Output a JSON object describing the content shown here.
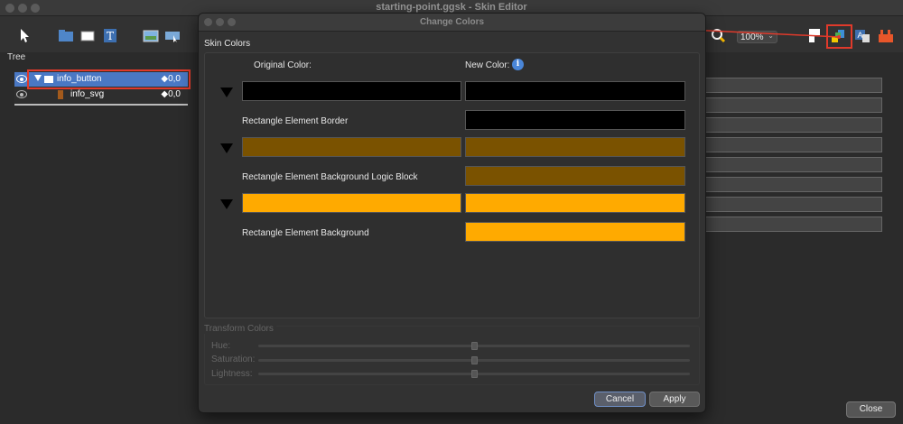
{
  "window": {
    "title": "starting-point.ggsk - Skin Editor",
    "zoom": "100%",
    "tree_label": "Tree",
    "close_label": "Close"
  },
  "tree": {
    "items": [
      {
        "name": "info_button",
        "value": "◆0,0",
        "selected": true
      },
      {
        "name": "info_svg",
        "value": "◆0,0",
        "selected": false
      }
    ]
  },
  "dialog": {
    "title": "Change Colors",
    "section_label": "Skin Colors",
    "original_color_label": "Original Color:",
    "new_color_label": "New Color:",
    "info_glyph": "i",
    "colors": [
      {
        "element": "",
        "original": "#000000",
        "new": "#000000"
      },
      {
        "element": "Rectangle Element Border",
        "original": "",
        "new": "#000000"
      },
      {
        "element": "",
        "original": "#7a5200",
        "new": "#7a5200"
      },
      {
        "element": "Rectangle Element Background Logic Block",
        "original": "",
        "new": "#7a5200"
      },
      {
        "element": "",
        "original": "#ffaa00",
        "new": "#ffaa00"
      },
      {
        "element": "Rectangle Element Background",
        "original": "",
        "new": "#ffaa00"
      }
    ],
    "transform": {
      "label": "Transform Colors",
      "hue_label": "Hue:",
      "saturation_label": "Saturation:",
      "lightness_label": "Lightness:"
    },
    "cancel_label": "Cancel",
    "apply_label": "Apply"
  },
  "colors": {
    "selection": "#4a78c4",
    "annotation": "#e03a2b"
  }
}
